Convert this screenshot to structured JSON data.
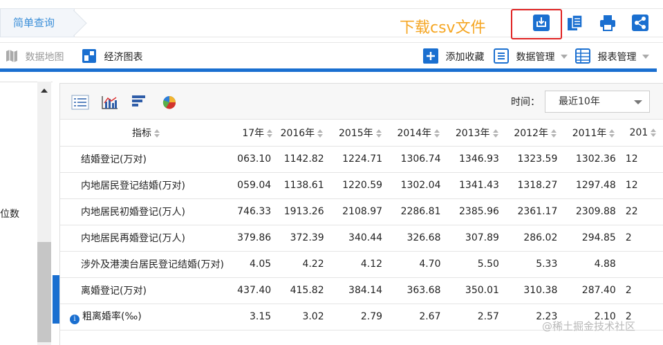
{
  "top": {
    "tab_label": "简单查询",
    "annotation": "下载csv文件"
  },
  "toolbar": {
    "map_label": "数据地图",
    "charts_label": "经济图表",
    "favorite_label": "添加收藏",
    "data_mgmt_label": "数据管理",
    "report_mgmt_label": "报表管理"
  },
  "left": {
    "partial_label": "位数"
  },
  "time": {
    "label": "时间：",
    "selected": "最近10年"
  },
  "table": {
    "indicator_header": "指标",
    "year_headers": [
      "17年",
      "2016年",
      "2015年",
      "2014年",
      "2013年",
      "2012年",
      "2011年",
      "201"
    ],
    "rows": [
      {
        "name": "结婚登记(万对)",
        "values": [
          "063.10",
          "1142.82",
          "1224.71",
          "1306.74",
          "1346.93",
          "1323.59",
          "1302.36",
          "12"
        ]
      },
      {
        "name": "内地居民登记结婚(万对)",
        "values": [
          "059.04",
          "1138.61",
          "1220.59",
          "1302.04",
          "1341.43",
          "1318.27",
          "1297.48",
          "12"
        ]
      },
      {
        "name": "内地居民初婚登记(万人)",
        "values": [
          "746.33",
          "1913.26",
          "2108.97",
          "2286.81",
          "2385.96",
          "2361.17",
          "2309.88",
          "22"
        ]
      },
      {
        "name": "内地居民再婚登记(万人)",
        "values": [
          "379.86",
          "372.39",
          "340.44",
          "326.68",
          "307.89",
          "286.02",
          "294.85",
          "2"
        ]
      },
      {
        "name": "涉外及港澳台居民登记结婚(万对)",
        "values": [
          "4.05",
          "4.22",
          "4.12",
          "4.70",
          "5.50",
          "5.33",
          "4.88",
          ""
        ]
      },
      {
        "name": "离婚登记(万对)",
        "values": [
          "437.40",
          "415.82",
          "384.14",
          "363.68",
          "350.01",
          "310.38",
          "287.40",
          "2"
        ]
      },
      {
        "name": "粗离婚率(‰)",
        "values": [
          "3.15",
          "3.02",
          "2.79",
          "2.67",
          "2.57",
          "2.23",
          "2.10",
          "2"
        ],
        "info": "i"
      }
    ]
  },
  "watermark": "@稀土掘金技术社区",
  "colors": {
    "accent": "#1a6fd0",
    "annotation": "#f5a623",
    "highlight_box": "#e02020"
  }
}
